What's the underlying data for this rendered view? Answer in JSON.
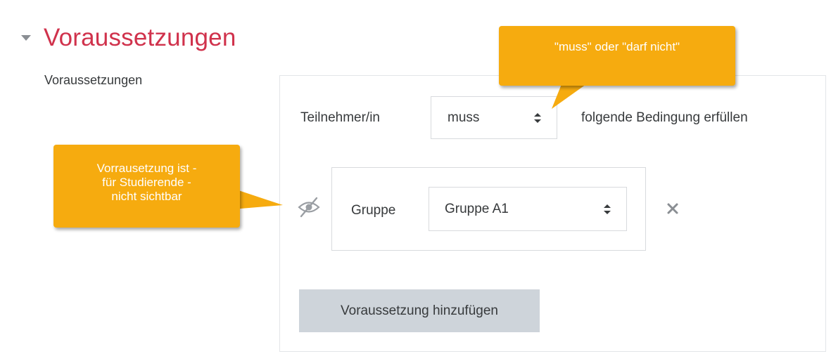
{
  "section": {
    "title": "Voraussetzungen",
    "caret_icon": "caret-down-icon",
    "title_color": "#d0324c"
  },
  "field_label": "Voraussetzungen",
  "restriction": {
    "participant_label": "Teilnehmer/in",
    "must_select_value": "muss",
    "condition_text": "folgende Bedingung erfüllen",
    "eye_icon": "eye-slash-icon",
    "group_label": "Gruppe",
    "group_select_value": "Gruppe A1",
    "remove_icon": "close-icon",
    "add_button_label": "Voraussetzung hinzufügen"
  },
  "callouts": {
    "top": "\"muss\" oder \"darf nicht\"",
    "left_lines": [
      "Vorrausetzung ist -",
      "für Studierende -",
      "nicht sichtbar"
    ],
    "color": "#f6ab0f"
  }
}
